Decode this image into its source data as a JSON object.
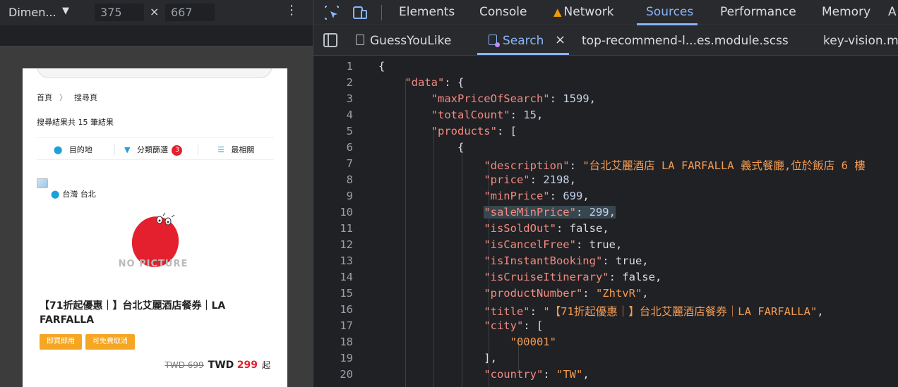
{
  "device_bar": {
    "name": "Dimen...",
    "width": "375",
    "height": "667",
    "times": "×"
  },
  "phone": {
    "breadcrumb": [
      "首頁",
      "搜尋頁"
    ],
    "result_count": "搜尋結果共 15 筆結果",
    "filters": {
      "destination": "目的地",
      "category": "分類篩選",
      "category_badge": "3",
      "sort": "最相關"
    },
    "location": "台灣 台北",
    "no_picture": "NO PICTURE",
    "product_title": "【71折起優惠｜】台北艾麗酒店餐券｜LA FARFALLA",
    "tags": [
      "即買即用",
      "可免費取消"
    ],
    "price": {
      "old": "TWD 699",
      "currency": "TWD",
      "value": "299",
      "suffix": "起"
    }
  },
  "devtools": {
    "tabs": [
      "Elements",
      "Console",
      "Network",
      "Sources",
      "Performance",
      "Memory",
      "A"
    ],
    "active_tab": "Sources",
    "network_warning": true,
    "file_tabs": [
      "GuessYouLike",
      "Search",
      "top-recommend-l...es.module.scss",
      "key-vision.m"
    ],
    "active_file": "Search",
    "close_glyph": "×",
    "accent": "#8ab4f8",
    "code_lines": [
      {
        "n": "1",
        "t": "{"
      },
      {
        "n": "2",
        "t": "    \"data\": {"
      },
      {
        "n": "3",
        "t": "        \"maxPriceOfSearch\": 1599,"
      },
      {
        "n": "4",
        "t": "        \"totalCount\": 15,"
      },
      {
        "n": "5",
        "t": "        \"products\": ["
      },
      {
        "n": "6",
        "t": "            {"
      },
      {
        "n": "7",
        "t": "                \"description\": \"台北艾麗酒店 LA FARFALLA 義式餐廳,位於飯店 6 樓"
      },
      {
        "n": "8",
        "t": "                \"price\": 2198,"
      },
      {
        "n": "9",
        "t": "                \"minPrice\": 699,"
      },
      {
        "n": "10",
        "t": "                \"saleMinPrice\": 299,"
      },
      {
        "n": "11",
        "t": "                \"isSoldOut\": false,"
      },
      {
        "n": "12",
        "t": "                \"isCancelFree\": true,"
      },
      {
        "n": "13",
        "t": "                \"isInstantBooking\": true,"
      },
      {
        "n": "14",
        "t": "                \"isCruiseItinerary\": false,"
      },
      {
        "n": "15",
        "t": "                \"productNumber\": \"ZhtvR\","
      },
      {
        "n": "16",
        "t": "                \"title\": \"【71折起優惠｜】台北艾麗酒店餐券｜LA FARFALLA\","
      },
      {
        "n": "17",
        "t": "                \"city\": ["
      },
      {
        "n": "18",
        "t": "                    \"00001\""
      },
      {
        "n": "19",
        "t": "                ],"
      },
      {
        "n": "20",
        "t": "                \"country\": \"TW\","
      }
    ],
    "highlighted_line": "10"
  }
}
